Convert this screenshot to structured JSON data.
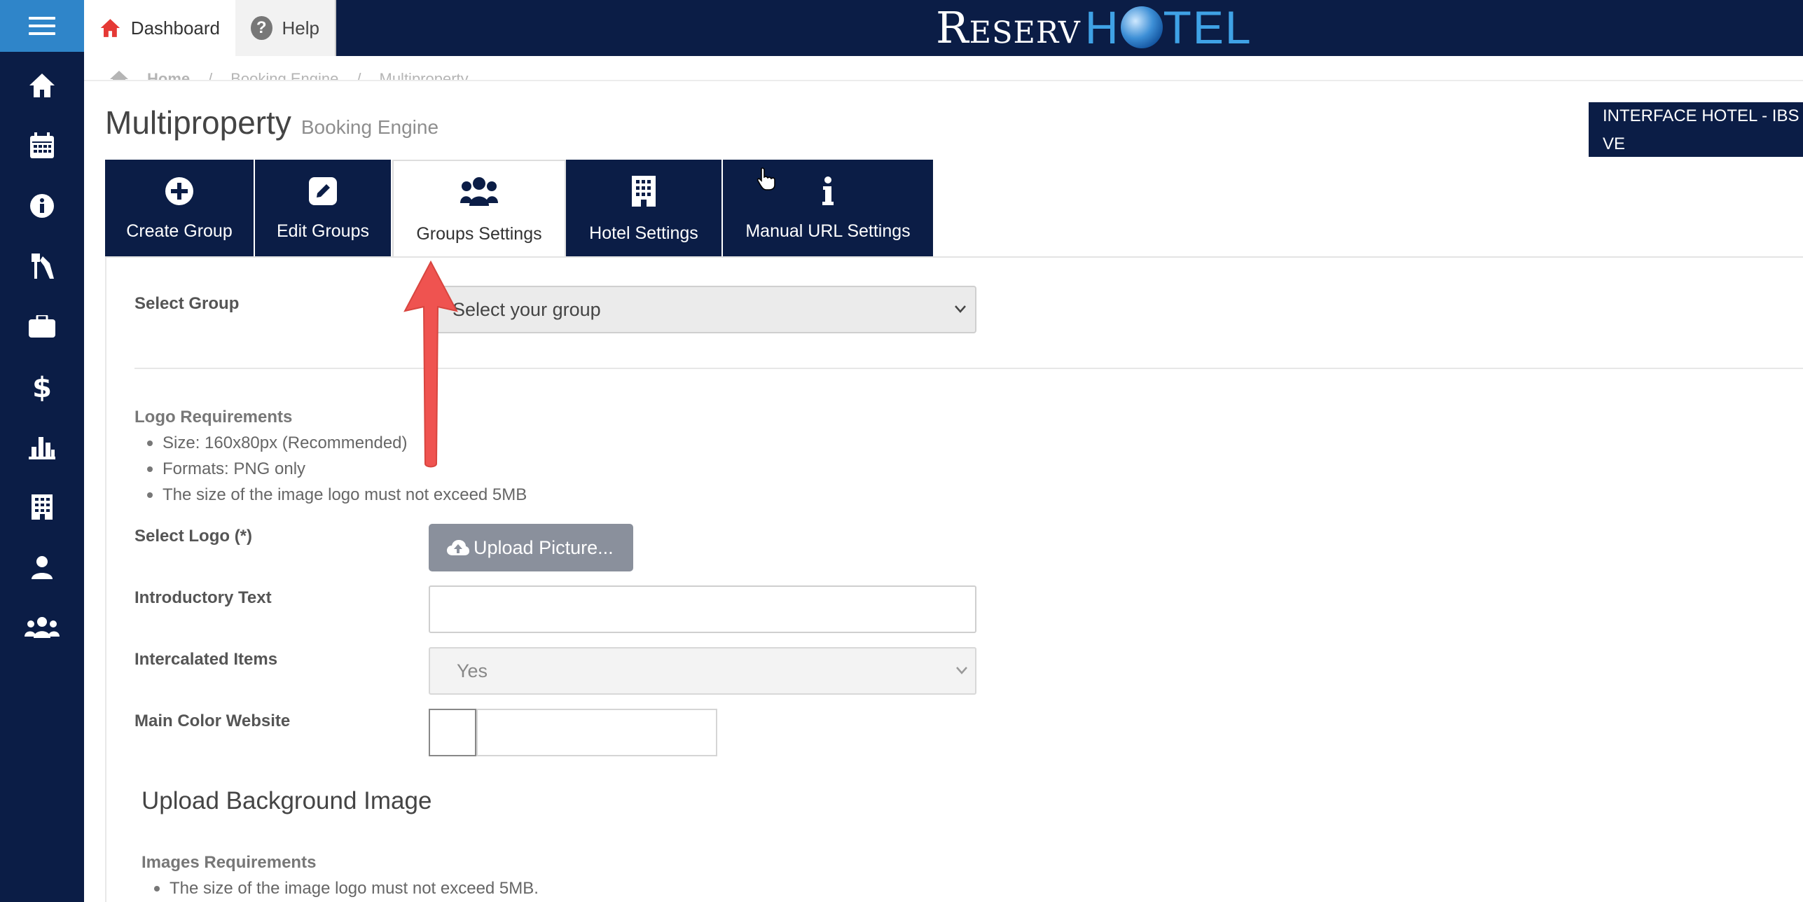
{
  "topbar": {
    "dashboard_label": "Dashboard",
    "help_label": "Help",
    "brand_left": "Reserv",
    "brand_h": "H",
    "brand_right": "TEL"
  },
  "breadcrumb": [
    "Home",
    "/",
    "Booking Engine",
    "/",
    "Multiproperty"
  ],
  "page": {
    "title": "Multiproperty",
    "subtitle": "Booking Engine",
    "hotel_badge_line1": "INTERFACE HOTEL - IBS",
    "hotel_badge_line2": "VE"
  },
  "tabs": [
    {
      "label": "Create Group",
      "icon": "plus-circle-icon"
    },
    {
      "label": "Edit Groups",
      "icon": "edit-icon"
    },
    {
      "label": "Groups Settings",
      "icon": "users-icon",
      "active": true
    },
    {
      "label": "Hotel Settings",
      "icon": "building-icon"
    },
    {
      "label": "Manual URL Settings",
      "icon": "info-icon"
    }
  ],
  "form": {
    "select_group_label": "Select Group",
    "select_group_value": "Select your group",
    "logo_requirements_title": "Logo Requirements",
    "logo_requirements": [
      "Size: 160x80px (Recommended)",
      "Formats: PNG only",
      "The size of the image logo must not exceed 5MB"
    ],
    "select_logo_label": "Select Logo (*)",
    "upload_button_label": "Upload Picture...",
    "intro_text_label": "Introductory Text",
    "intro_text_value": "",
    "intercalated_label": "Intercalated Items",
    "intercalated_value": "Yes",
    "main_color_label": "Main Color Website",
    "main_color_value": ""
  },
  "background_section": {
    "heading": "Upload Background Image",
    "requirements_title": "Images Requirements",
    "requirements": [
      "The size of the image logo must not exceed 5MB."
    ]
  },
  "colors": {
    "navy": "#0b1d46",
    "hamburger_blue": "#2f85c9",
    "arrow_red": "#ef5350",
    "upload_gray": "#8a909c"
  },
  "sidebar_icons": [
    "home-icon",
    "calendar-icon",
    "info-icon",
    "tools-icon",
    "briefcase-icon",
    "dollar-icon",
    "bar-chart-icon",
    "building-icon",
    "user-icon",
    "users-icon"
  ]
}
